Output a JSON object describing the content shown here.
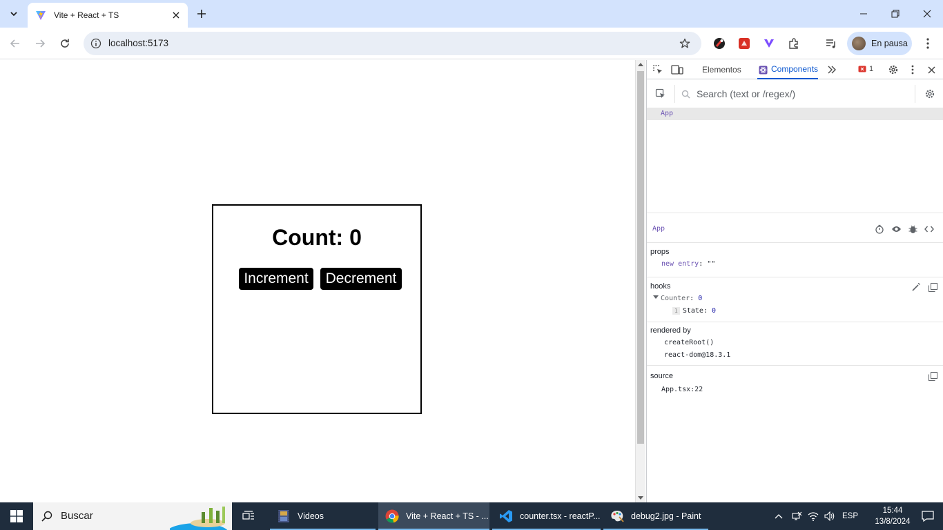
{
  "browser": {
    "tab_title": "Vite + React + TS",
    "url": "localhost:5173",
    "profile_label": "En pausa"
  },
  "page": {
    "count_text": "Count: 0",
    "increment_label": "Increment",
    "decrement_label": "Decrement"
  },
  "devtools": {
    "tabs": [
      "Elementos",
      "Components"
    ],
    "error_count": "1",
    "search_placeholder": "Search (text or /regex/)",
    "tree_root": "App",
    "selected_component": "App",
    "props": {
      "title": "props",
      "key": "new entry",
      "value": "\"\""
    },
    "hooks": {
      "title": "hooks",
      "custom_hook": "Counter",
      "custom_hook_value": "0",
      "state_index": "1",
      "state_label": "State",
      "state_value": "0"
    },
    "rendered_by": {
      "title": "rendered by",
      "items": [
        "createRoot()",
        "react-dom@18.3.1"
      ]
    },
    "source": {
      "title": "source",
      "file": "App.tsx:22"
    }
  },
  "taskbar": {
    "search_label": "Buscar",
    "apps": [
      {
        "label": "Videos"
      },
      {
        "label": "Vite + React + TS - ..."
      },
      {
        "label": "counter.tsx - reactP..."
      },
      {
        "label": "debug2.jpg - Paint"
      }
    ],
    "language": "ESP",
    "time": "15:44",
    "date": "13/8/2024"
  },
  "colors": {
    "tab_strip": "#d3e3fd",
    "omnibox": "#e9eef6",
    "devtools_accent": "#0b57d0",
    "react_component": "#6a51b2",
    "taskbar": "#1f2d3d"
  }
}
